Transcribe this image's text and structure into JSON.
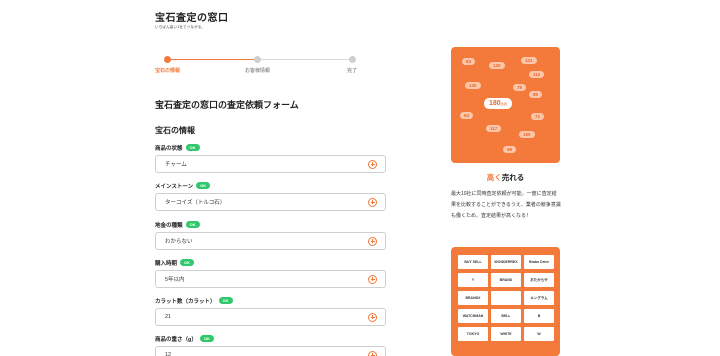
{
  "logo": {
    "title": "宝石査定の窓口",
    "subtitle": "いちばん高い1社でつながる。"
  },
  "steps": [
    {
      "label": "宝石の情報",
      "active": true
    },
    {
      "label": "お客様情報",
      "active": false
    },
    {
      "label": "完了",
      "active": false
    }
  ],
  "form": {
    "title": "宝石査定の窓口の査定依頼フォーム",
    "section_title": "宝石の情報",
    "fields": [
      {
        "label": "商品の状態",
        "badge": "OK",
        "value": "チャーム"
      },
      {
        "label": "メインストーン",
        "badge": "OK",
        "value": "ターコイズ（トルコ石）"
      },
      {
        "label": "地金の種類",
        "badge": "OK",
        "value": "わからない"
      },
      {
        "label": "購入時期",
        "badge": "OK",
        "value": "5年以内"
      },
      {
        "label": "カラット数（カラット）",
        "badge": "OK",
        "value": "21"
      },
      {
        "label": "商品の重さ（g）",
        "badge": "OK",
        "value": "12"
      }
    ]
  },
  "promo": {
    "bubbles": [
      "83",
      "120",
      "121",
      "112",
      "140",
      "79",
      "180",
      "85",
      "94",
      "72",
      "117",
      "150",
      "98"
    ],
    "bubble_unit": "万円",
    "heading_accent": "高く",
    "heading_rest": "売れる",
    "text": "最大10社に同時査定依頼が可能。一度に査定結果を比較することができるうえ、業者の競争意識も働くため、査定結果が高くなる！"
  },
  "partners": {
    "tiles": [
      "BUY SELL",
      "WONDERREX",
      "Brabo Drive",
      "Y",
      "BRAND",
      "おたからや",
      "BRANDX",
      "",
      "キングラム",
      "WATCHMAN",
      "BELL",
      "B",
      "TOKYO",
      "WHITE",
      "W"
    ]
  },
  "colors": {
    "accent": "#f47a3c",
    "badge": "#31c86b"
  }
}
